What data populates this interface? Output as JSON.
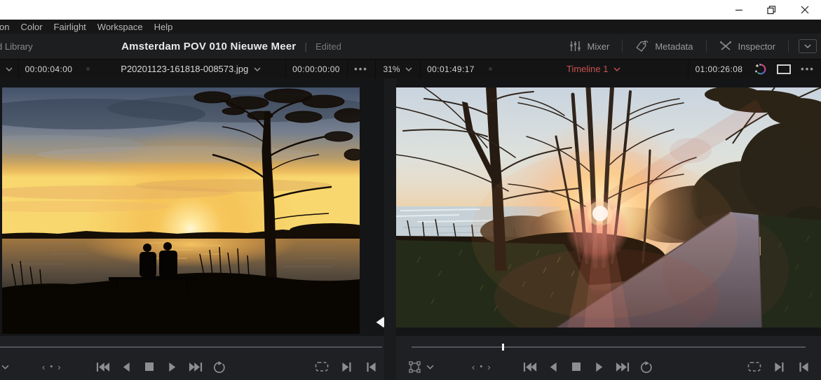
{
  "titlebar": {
    "controls": [
      {
        "name": "minimize"
      },
      {
        "name": "maximize-restore"
      },
      {
        "name": "close"
      }
    ]
  },
  "menu_bar": {
    "items": [
      "on",
      "Color",
      "Fairlight",
      "Workspace",
      "Help"
    ]
  },
  "header": {
    "library_label": "d Library",
    "project_title": "Amsterdam POV 010 Nieuwe Meer",
    "separator": "|",
    "status": "Edited",
    "panel_buttons": [
      {
        "label": "Mixer",
        "icon": "mixer-icon"
      },
      {
        "label": "Metadata",
        "icon": "metadata-tag-icon"
      },
      {
        "label": "Inspector",
        "icon": "inspector-icon"
      }
    ],
    "dropdown_icon": "chevron-down-icon"
  },
  "source_viewer": {
    "timecode_left": "00:00:04:00",
    "clip_name": "P20201123-161818-008573.jpg",
    "timecode_right": "00:00:00:00",
    "options": "•••",
    "overlay_icon": "in-point-marker",
    "image_description": "Sunset over a lake, two people silhouetted on a bench, bare tree on the right"
  },
  "timeline_viewer": {
    "zoom_level": "31%",
    "timecode_left": "00:01:49:17",
    "timeline_name": "Timeline 1",
    "timecode_right": "01:00:26:08",
    "options": "•••",
    "playhead_position_pct": 23,
    "image_description": "Low sun flaring through bare trees next to a lakeside path"
  },
  "transport": {
    "jog_left": "‹",
    "jog_dot": "•",
    "jog_right": "›",
    "buttons": [
      "skip-to-start",
      "step-back",
      "stop",
      "play",
      "skip-to-end",
      "loop"
    ],
    "right_buttons": [
      "loop-clip",
      "next-edit",
      "prev-edit"
    ]
  },
  "colors": {
    "timeline_name": "#c9534f",
    "titlebar_bg": "#ffffff",
    "chrome_bg": "#161616"
  }
}
